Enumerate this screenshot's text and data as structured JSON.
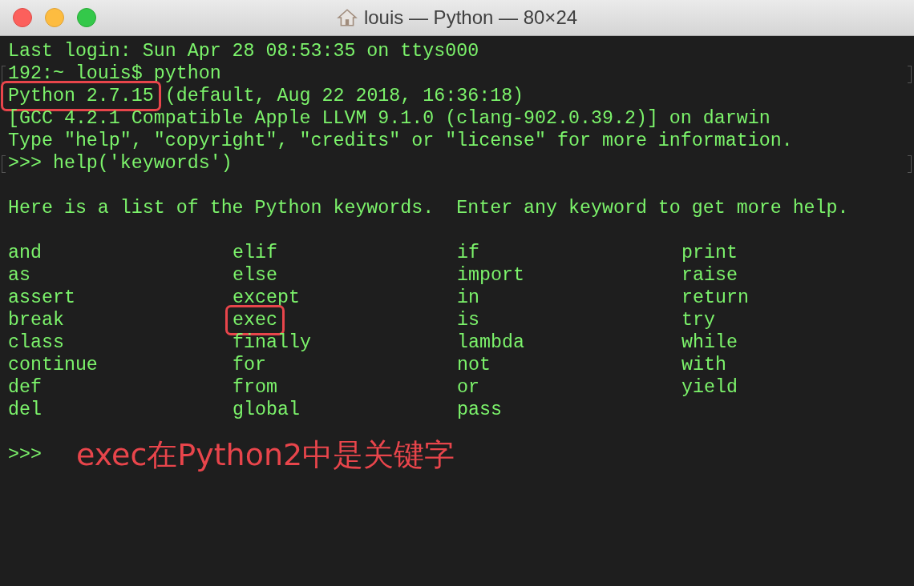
{
  "window": {
    "title": "louis — Python — 80×24"
  },
  "lines": [
    {
      "marked": false,
      "segments": [
        {
          "text": "Last login: Sun Apr 28 08:53:35 on ttys000",
          "circled": false
        }
      ]
    },
    {
      "marked": true,
      "segments": [
        {
          "text": "192:~ louis$ python",
          "circled": false
        }
      ]
    },
    {
      "marked": false,
      "segments": [
        {
          "text": "Python 2.7.15",
          "circled": true
        },
        {
          "text": " (default, Aug 22 2018, 16:36:18)",
          "circled": false
        }
      ]
    },
    {
      "marked": false,
      "segments": [
        {
          "text": "[GCC 4.2.1 Compatible Apple LLVM 9.1.0 (clang-902.0.39.2)] on darwin",
          "circled": false
        }
      ]
    },
    {
      "marked": false,
      "segments": [
        {
          "text": "Type \"help\", \"copyright\", \"credits\" or \"license\" for more information.",
          "circled": false
        }
      ]
    },
    {
      "marked": true,
      "segments": [
        {
          "text": ">>> help('keywords')",
          "circled": false
        }
      ]
    }
  ],
  "intro": "Here is a list of the Python keywords.  Enter any keyword to get more help.",
  "keywords": [
    {
      "word": "and",
      "circled": false
    },
    {
      "word": "elif",
      "circled": false
    },
    {
      "word": "if",
      "circled": false
    },
    {
      "word": "print",
      "circled": false
    },
    {
      "word": "as",
      "circled": false
    },
    {
      "word": "else",
      "circled": false
    },
    {
      "word": "import",
      "circled": false
    },
    {
      "word": "raise",
      "circled": false
    },
    {
      "word": "assert",
      "circled": false
    },
    {
      "word": "except",
      "circled": false
    },
    {
      "word": "in",
      "circled": false
    },
    {
      "word": "return",
      "circled": false
    },
    {
      "word": "break",
      "circled": false
    },
    {
      "word": "exec",
      "circled": true
    },
    {
      "word": "is",
      "circled": false
    },
    {
      "word": "try",
      "circled": false
    },
    {
      "word": "class",
      "circled": false
    },
    {
      "word": "finally",
      "circled": false
    },
    {
      "word": "lambda",
      "circled": false
    },
    {
      "word": "while",
      "circled": false
    },
    {
      "word": "continue",
      "circled": false
    },
    {
      "word": "for",
      "circled": false
    },
    {
      "word": "not",
      "circled": false
    },
    {
      "word": "with",
      "circled": false
    },
    {
      "word": "def",
      "circled": false
    },
    {
      "word": "from",
      "circled": false
    },
    {
      "word": "or",
      "circled": false
    },
    {
      "word": "yield",
      "circled": false
    },
    {
      "word": "del",
      "circled": false
    },
    {
      "word": "global",
      "circled": false
    },
    {
      "word": "pass",
      "circled": false
    }
  ],
  "prompt": ">>>",
  "annotation": "exec在Python2中是关键字"
}
